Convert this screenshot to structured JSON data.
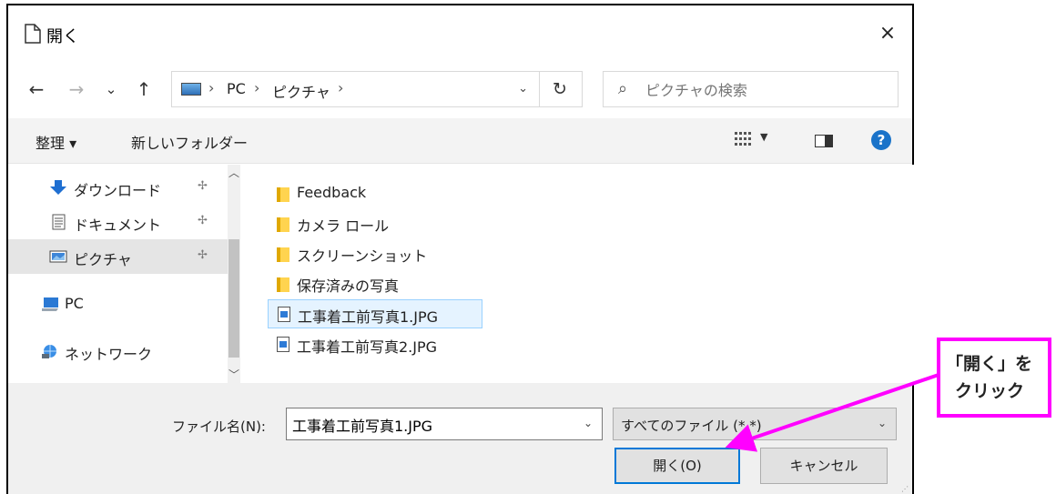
{
  "dialog": {
    "title": "開く",
    "close_label": "×"
  },
  "address_bar": {
    "back_icon": "←",
    "forward_icon": "→",
    "recent_icon": "⌄",
    "up_icon": "↑",
    "breadcrumbs": [
      "PC",
      "ピクチャ"
    ],
    "separator": "›",
    "dropdown_icon": "⌄",
    "refresh_icon": "↻"
  },
  "search": {
    "placeholder": "ピクチャの検索",
    "icon": "⌕"
  },
  "toolbar": {
    "organize_label": "整理 ▾",
    "new_folder_label": "新しいフォルダー",
    "view_dropdown": "▼",
    "help_label": "?"
  },
  "nav_pane": {
    "items": [
      {
        "label": "ダウンロード",
        "icon": "download-arrow-icon",
        "pinned": true
      },
      {
        "label": "ドキュメント",
        "icon": "document-icon",
        "pinned": true
      },
      {
        "label": "ピクチャ",
        "icon": "pictures-icon",
        "pinned": true,
        "selected": true
      },
      {
        "label": "PC",
        "icon": "pc-icon"
      },
      {
        "label": "ネットワーク",
        "icon": "network-icon"
      }
    ],
    "pin_glyph": "📌"
  },
  "file_list": {
    "items": [
      {
        "label": "Feedback",
        "type": "folder"
      },
      {
        "label": "カメラ ロール",
        "type": "folder"
      },
      {
        "label": "スクリーンショット",
        "type": "folder"
      },
      {
        "label": "保存済みの写真",
        "type": "folder"
      },
      {
        "label": "工事着工前写真1.JPG",
        "type": "image",
        "selected": true
      },
      {
        "label": "工事着工前写真2.JPG",
        "type": "image"
      }
    ]
  },
  "bottom": {
    "filename_label": "ファイル名(N):",
    "filename_value": "工事着工前写真1.JPG",
    "filetype_value": "すべてのファイル (*.*)",
    "open_label": "開く(O)",
    "cancel_label": "キャンセル",
    "drop_icon": "⌄"
  },
  "callout": {
    "line1": "「開く」を",
    "line2": "クリック",
    "color": "#ff00ff"
  }
}
